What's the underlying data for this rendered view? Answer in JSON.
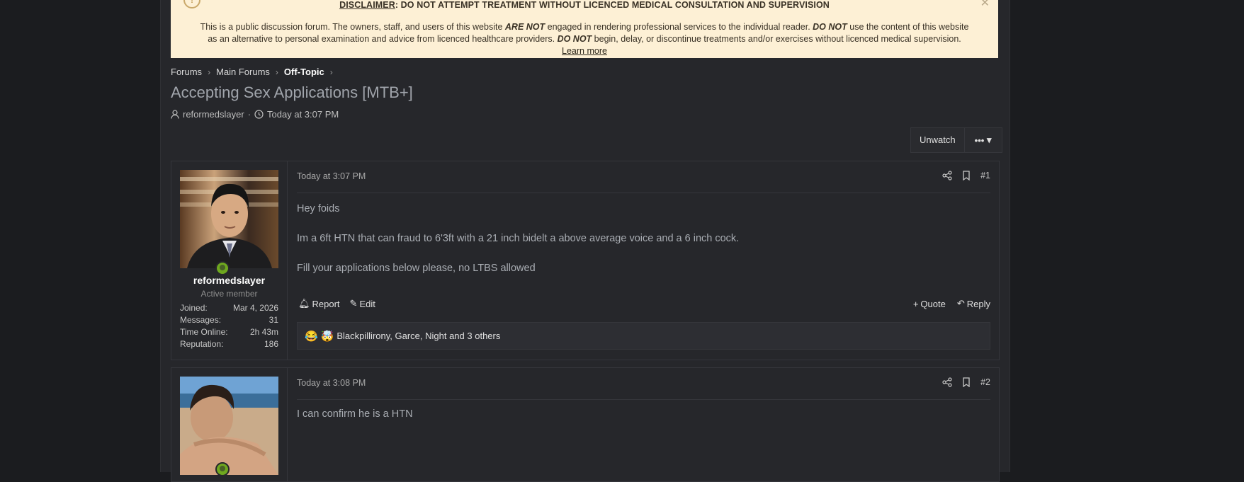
{
  "notice": {
    "headline_prefix": "DISCLAIMER",
    "headline_rest": ": DO NOT ATTEMPT TREATMENT WITHOUT LICENCED MEDICAL CONSULTATION AND SUPERVISION",
    "body_1": "This is a public discussion forum. The owners, staff, and users of this website ",
    "body_2": "ARE NOT",
    "body_3": " engaged in rendering professional services to the individual reader. ",
    "body_4": "DO NOT",
    "body_5": " use the content of this website as an alternative to personal examination and advice from licenced healthcare providers. ",
    "body_6": "DO NOT",
    "body_7": " begin, delay, or discontinue treatments and/or exercises without licenced medical supervision. ",
    "learn_more": "Learn more"
  },
  "breadcrumb": [
    "Forums",
    "Main Forums",
    "Off-Topic"
  ],
  "thread": {
    "title": "Accepting Sex Applications [MTB+]",
    "author": "reformedslayer",
    "date": "Today at 3:07 PM"
  },
  "watch_bar": {
    "unwatch": "Unwatch",
    "more": "•••"
  },
  "posts": [
    {
      "date": "Today at 3:07 PM",
      "number": "#1",
      "username": "reformedslayer",
      "usertitle": "Active member",
      "stats": [
        {
          "label": "Joined:",
          "value": "Mar 4, 2026"
        },
        {
          "label": "Messages:",
          "value": "31"
        },
        {
          "label": "Time Online:",
          "value": "2h 43m"
        },
        {
          "label": "Reputation:",
          "value": "186"
        }
      ],
      "body": [
        "Hey foids",
        "Im a 6ft HTN that can fraud to 6'3ft with a 21 inch bidelt a above average voice and a 6 inch cock.",
        "Fill your applications below please, no LTBS allowed"
      ],
      "actions": {
        "report": "Report",
        "edit": "Edit",
        "quote": "Quote",
        "reply": "Reply"
      },
      "reactions": "Blackpillirony, Garce, Night and 3 others"
    },
    {
      "date": "Today at 3:08 PM",
      "number": "#2",
      "body": [
        "I can confirm he is a HTN"
      ]
    }
  ]
}
